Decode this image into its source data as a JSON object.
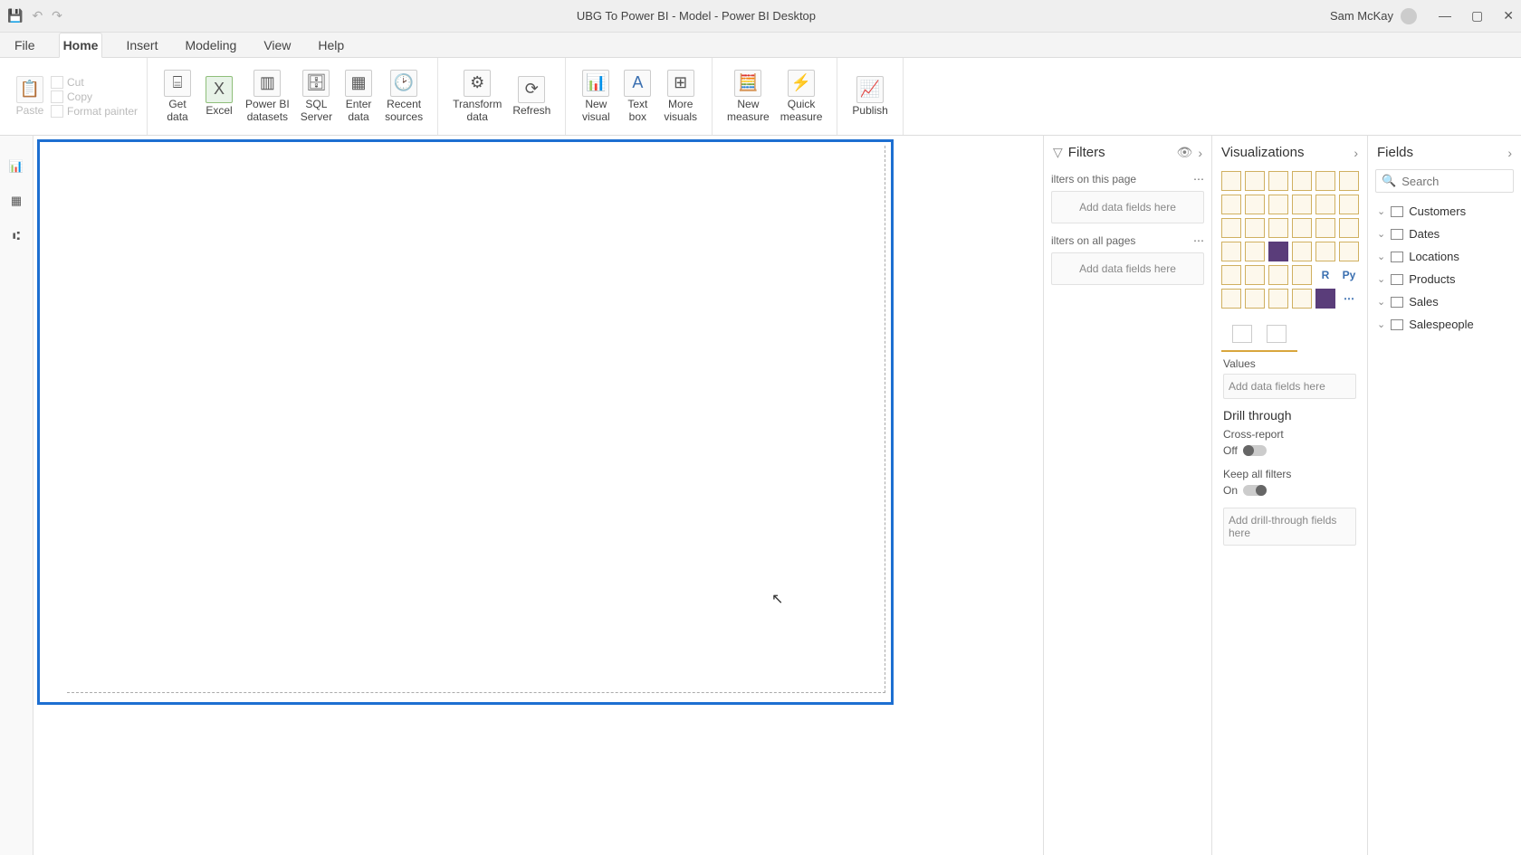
{
  "titlebar": {
    "title": "UBG To Power BI - Model - Power BI Desktop",
    "user": "Sam McKay"
  },
  "menu": {
    "tabs": [
      "File",
      "Home",
      "Insert",
      "Modeling",
      "View",
      "Help"
    ],
    "active": "Home"
  },
  "ribbon": {
    "paste": "Paste",
    "cut": "Cut",
    "copy": "Copy",
    "formatpainter": "Format painter",
    "getdata": "Get\ndata",
    "excel": "Excel",
    "pbidatasets": "Power BI\ndatasets",
    "sqlserver": "SQL\nServer",
    "enterdata": "Enter\ndata",
    "recentsources": "Recent\nsources",
    "transformdata": "Transform\ndata",
    "refresh": "Refresh",
    "newvisual": "New\nvisual",
    "textbox": "Text\nbox",
    "morevisuals": "More\nvisuals",
    "newmeasure": "New\nmeasure",
    "quickmeasure": "Quick\nmeasure",
    "publish": "Publish"
  },
  "filters": {
    "title": "Filters",
    "onpage": "ilters on this page",
    "onall": "ilters on all pages",
    "adddata": "Add data fields here"
  },
  "viz": {
    "title": "Visualizations",
    "values": "Values",
    "adddata": "Add data fields here",
    "drill": "Drill through",
    "cross": "Cross-report",
    "off": "Off",
    "keepall": "Keep all filters",
    "on": "On",
    "adddrill": "Add drill-through fields here"
  },
  "fields": {
    "title": "Fields",
    "searchPlaceholder": "Search",
    "items": [
      "Customers",
      "Dates",
      "Locations",
      "Products",
      "Sales",
      "Salespeople"
    ]
  }
}
